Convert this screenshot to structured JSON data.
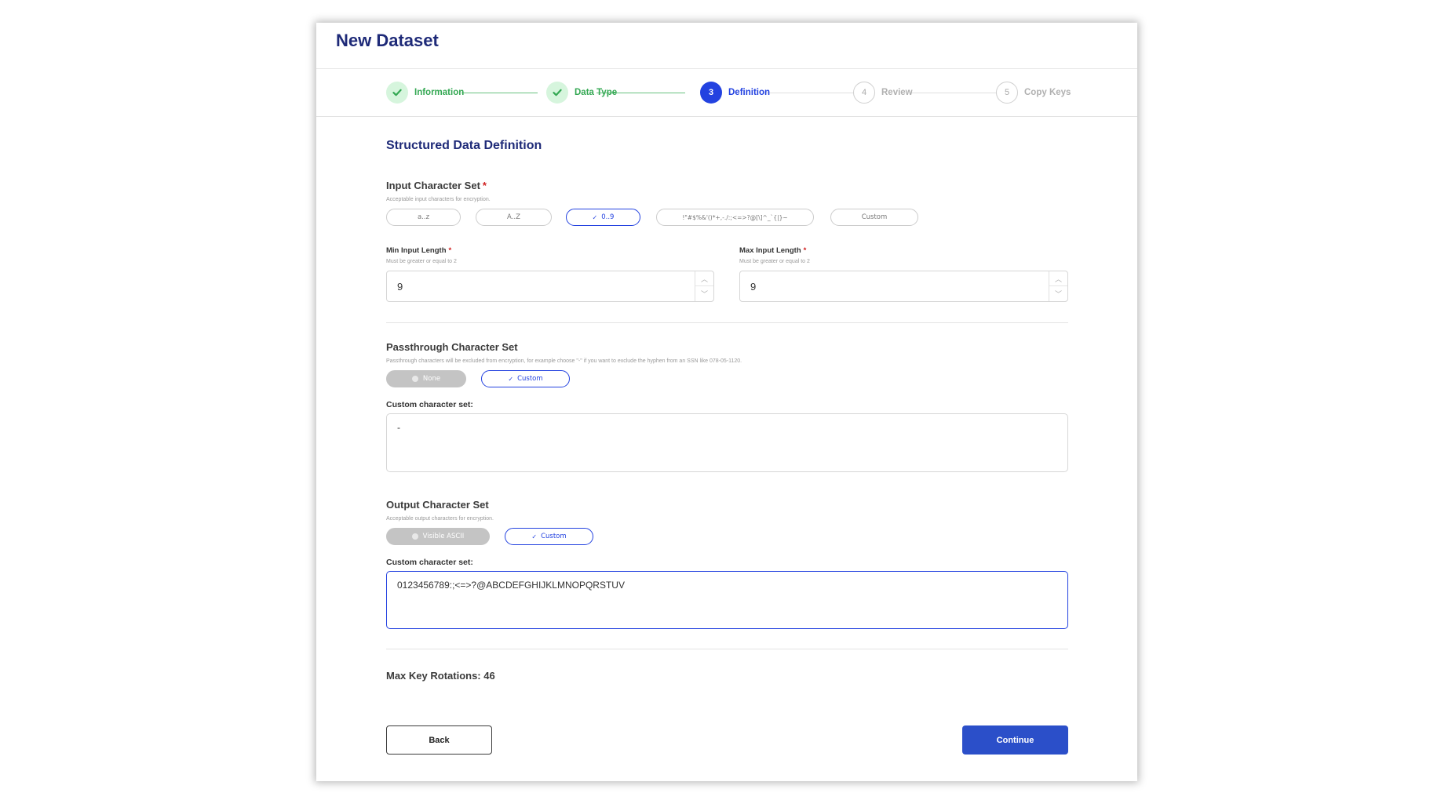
{
  "page": {
    "title": "New Dataset"
  },
  "stepper": {
    "steps": [
      {
        "number": "",
        "label": "Information",
        "state": "done"
      },
      {
        "number": "",
        "label": "Data Type",
        "state": "done"
      },
      {
        "number": "3",
        "label": "Definition",
        "state": "active"
      },
      {
        "number": "4",
        "label": "Review",
        "state": "todo"
      },
      {
        "number": "5",
        "label": "Copy Keys",
        "state": "todo"
      }
    ]
  },
  "form": {
    "title": "Structured Data Definition",
    "input_charset": {
      "label": "Input Character Set",
      "required_mark": "*",
      "hint": "Acceptable input characters for encryption.",
      "options": [
        {
          "label": "a..z",
          "selected": false
        },
        {
          "label": "A..Z",
          "selected": false
        },
        {
          "label": "0..9",
          "selected": true
        },
        {
          "label": "!\"#$%&'()*+,-./:;<=>?@[\\]^_`{|}~",
          "selected": false
        },
        {
          "label": "Custom",
          "selected": false
        }
      ]
    },
    "min_length": {
      "label": "Min Input Length",
      "required_mark": "*",
      "hint": "Must be greater or equal to 2",
      "value": "9"
    },
    "max_length": {
      "label": "Max Input Length",
      "required_mark": "*",
      "hint": "Must be greater or equal to 2",
      "value": "9"
    },
    "passthrough": {
      "label": "Passthrough Character Set",
      "hint": "Passthrough characters will be excluded from encryption, for example choose \"-\" if you want to exclude the hyphen from an SSN like 078-05-1120.",
      "options": [
        {
          "label": "None",
          "selected": false
        },
        {
          "label": "Custom",
          "selected": true
        }
      ],
      "custom_label": "Custom character set:",
      "custom_value": "-"
    },
    "output_charset": {
      "label": "Output Character Set",
      "hint": "Acceptable output characters for encryption.",
      "options": [
        {
          "label": "Visible ASCII",
          "selected": false
        },
        {
          "label": "Custom",
          "selected": true
        }
      ],
      "custom_label": "Custom character set:",
      "custom_value": "0123456789:;<=>?@ABCDEFGHIJKLMNOPQRSTUV"
    },
    "max_key_rotations": "Max Key Rotations: 46"
  },
  "actions": {
    "back_label": "Back",
    "continue_label": "Continue"
  },
  "colors": {
    "primary": "#2342e0",
    "success": "#34a853",
    "title": "#1e2a78",
    "button": "#2b4fc9"
  },
  "icons": {
    "done_step": "check-icon",
    "selected_option": "check-icon",
    "spinner_up": "chevron-up-icon",
    "spinner_down": "chevron-down-icon"
  }
}
